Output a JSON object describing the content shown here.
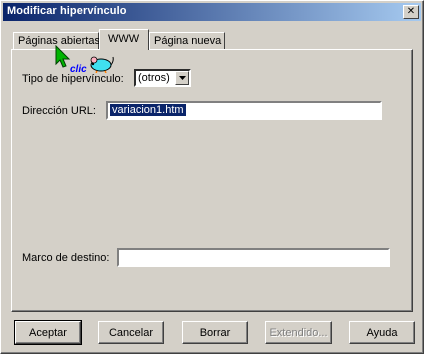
{
  "window": {
    "title": "Modificar hipervínculo",
    "close_glyph": "✕"
  },
  "tabs": [
    {
      "label": "Páginas abiertas",
      "active": false
    },
    {
      "label": "WWW",
      "active": true
    },
    {
      "label": "Página nueva",
      "active": false
    }
  ],
  "annotation": {
    "clic_text": "clic",
    "cursor_icon": "green-arrow-cursor",
    "mouse_icon": "cartoon-mouse"
  },
  "form": {
    "link_type_label": "Tipo de hipervínculo:",
    "link_type_value": "(otros)",
    "url_label": "Dirección URL:",
    "url_value": "variacion1.htm",
    "target_label": "Marco de destino:",
    "target_value": ""
  },
  "buttons": {
    "accept": "Aceptar",
    "cancel": "Cancelar",
    "delete": "Borrar",
    "extended": "Extendido...",
    "help": "Ayuda"
  },
  "colors": {
    "title_gradient_start": "#0a246a",
    "title_gradient_end": "#a6caf0",
    "face": "#d4d0c8",
    "selection": "#0a246a",
    "clic_text": "#0000ff",
    "cursor": "#00b400",
    "mouse_body": "#40e0f0"
  }
}
